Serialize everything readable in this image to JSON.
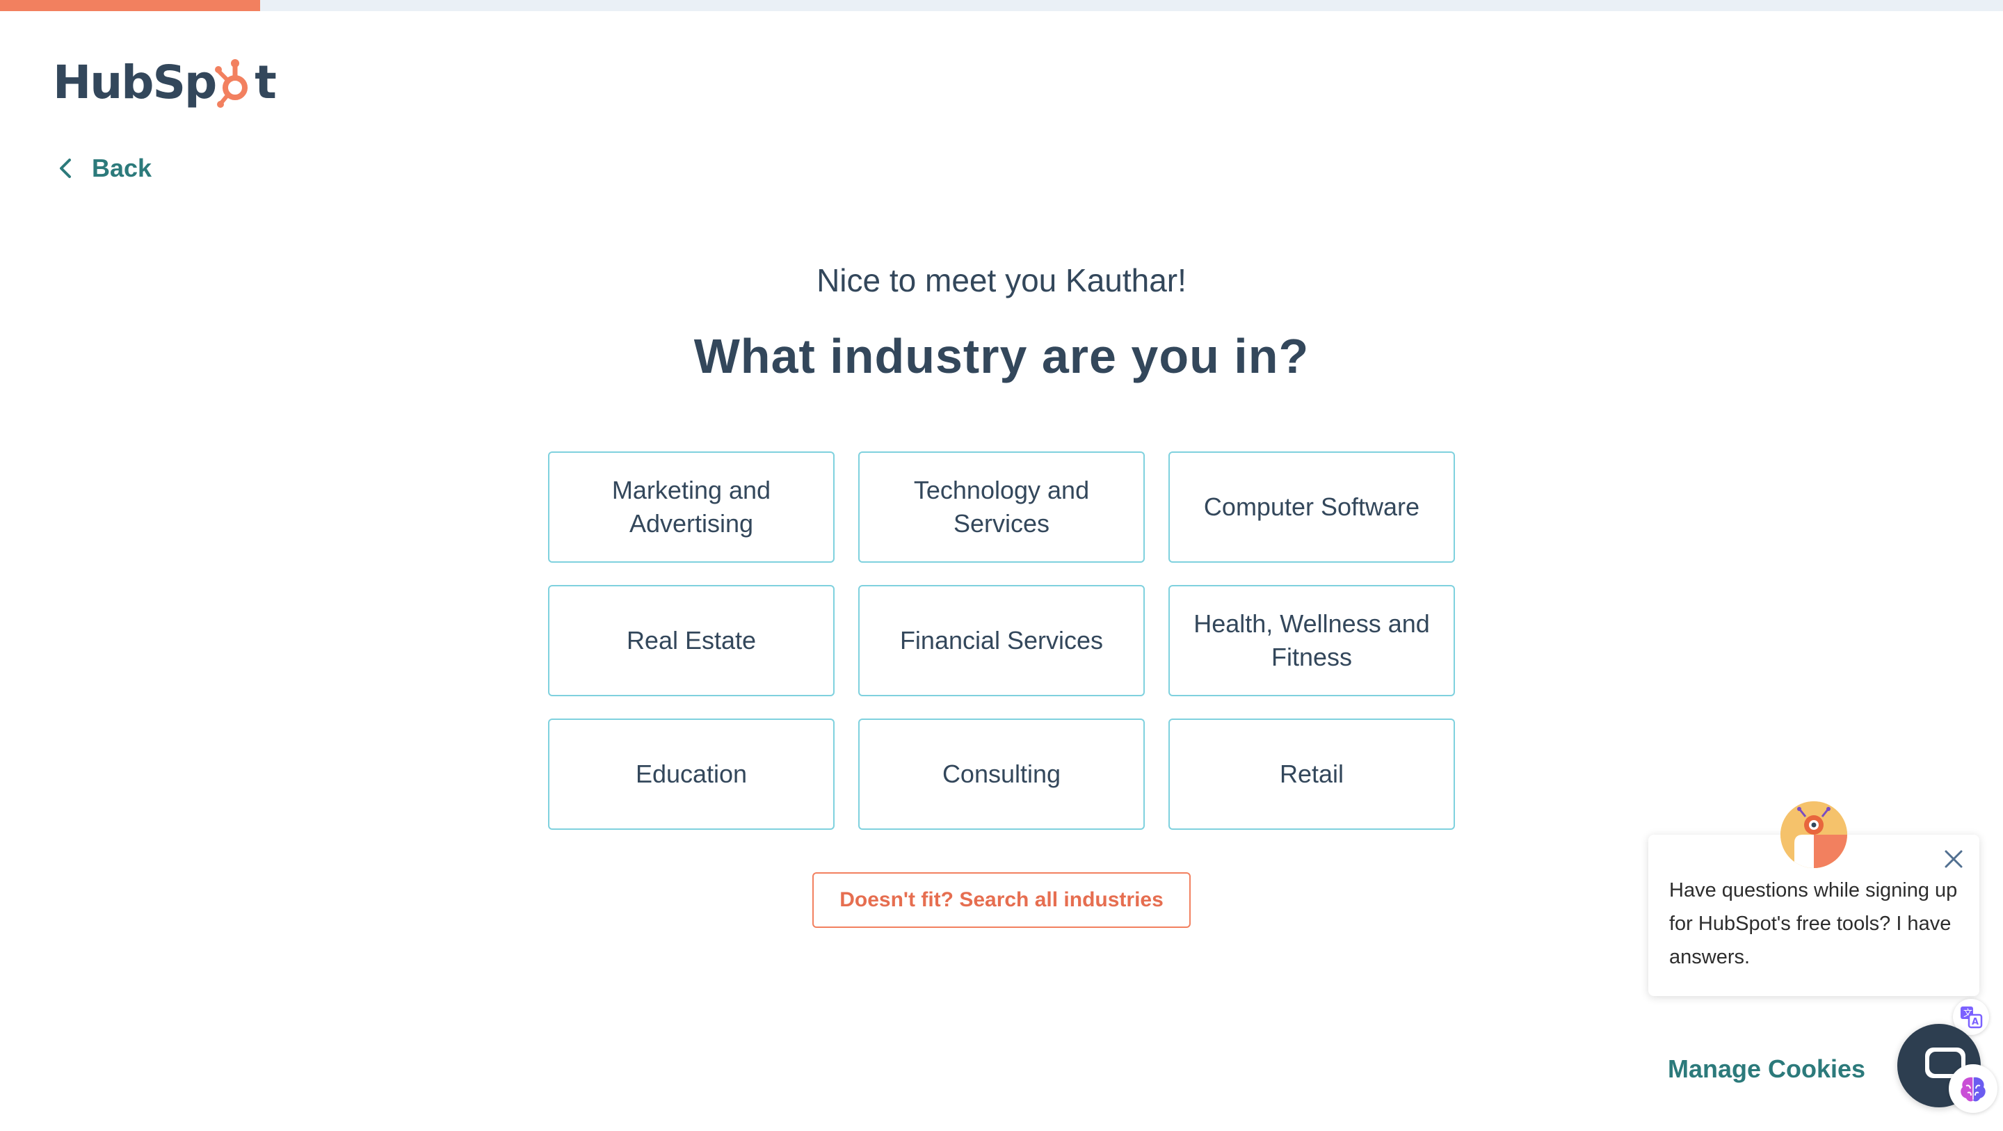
{
  "progress": {
    "fraction": 0.13,
    "fill_color": "#f2805f",
    "track_color": "#eaf0f6"
  },
  "logo": {
    "part1": "HubSp",
    "part2": "t",
    "sprocket_color": "#f2805f"
  },
  "nav": {
    "back_label": "Back",
    "back_icon": "chevron-left-icon"
  },
  "heading": {
    "greeting": "Nice to meet you Kauthar!",
    "question": "What industry are you in?"
  },
  "industries": [
    {
      "label": "Marketing and Advertising",
      "name": "industry-marketing-and-advertising"
    },
    {
      "label": "Technology and Services",
      "name": "industry-technology-and-services"
    },
    {
      "label": "Computer Software",
      "name": "industry-computer-software"
    },
    {
      "label": "Real Estate",
      "name": "industry-real-estate"
    },
    {
      "label": "Financial Services",
      "name": "industry-financial-services"
    },
    {
      "label": "Health, Wellness and Fitness",
      "name": "industry-health-wellness-fitness"
    },
    {
      "label": "Education",
      "name": "industry-education"
    },
    {
      "label": "Consulting",
      "name": "industry-consulting"
    },
    {
      "label": "Retail",
      "name": "industry-retail"
    }
  ],
  "search": {
    "label": "Doesn't fit? Search all industries"
  },
  "chat": {
    "message": "Have questions while signing up for HubSpot's free tools? I have answers.",
    "close_icon": "close-icon",
    "avatar_icon": "bot-avatar-icon"
  },
  "footer": {
    "manage_cookies": "Manage Cookies"
  },
  "colors": {
    "text": "#33475b",
    "tile_border": "#7fd1de",
    "accent": "#f2805f",
    "link": "#2c7a7b"
  }
}
